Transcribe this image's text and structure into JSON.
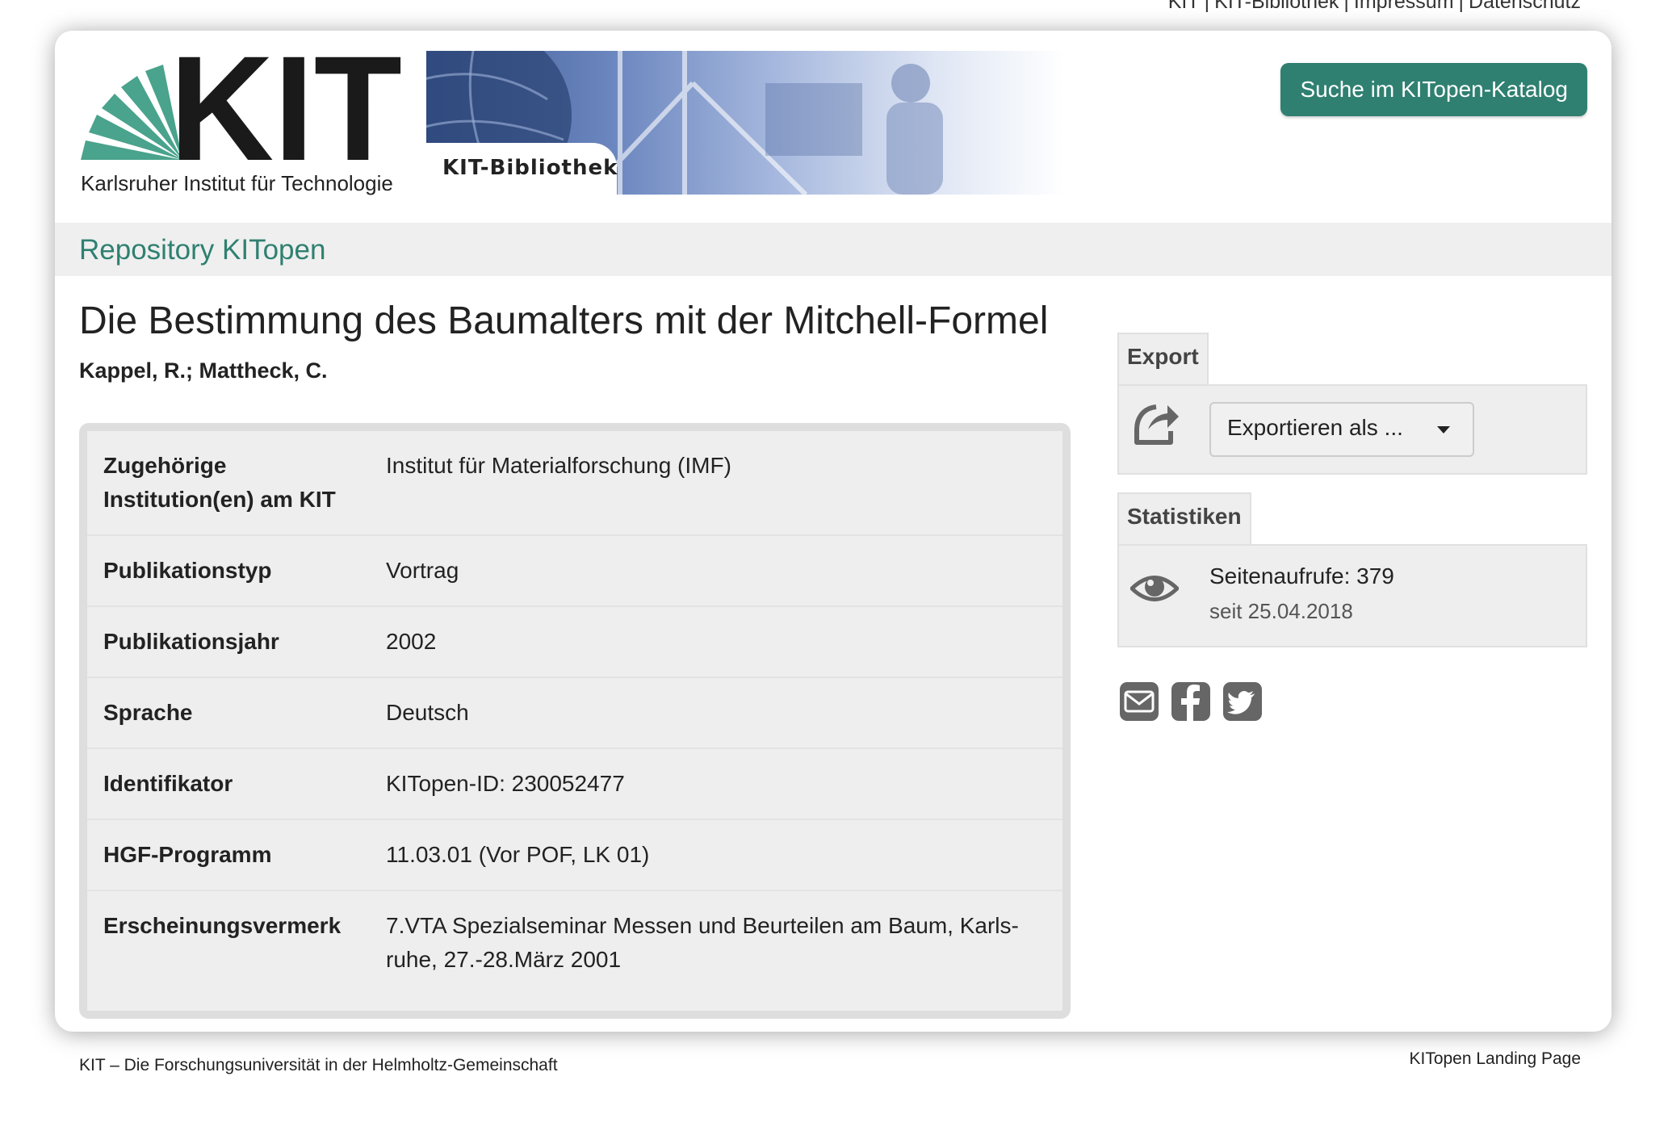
{
  "topnav": {
    "items": [
      "KIT",
      "KIT-Bibliothek",
      "Impressum",
      "Datenschutz"
    ],
    "separator": "|"
  },
  "header": {
    "logo_text": "KIT",
    "tagline": "Karlsruher Institut für Technologie",
    "banner_label": "KIT-Bibliothek",
    "search_button": "Suche im KITopen-Katalog"
  },
  "repo": {
    "title": "Repository KITopen"
  },
  "document": {
    "title": "Die Bestimmung des Baumalters mit der Mitchell-Formel",
    "authors": "Kappel, R.; Mattheck, C."
  },
  "metadata": [
    {
      "key": "Zugehörige Institution(en) am KIT",
      "value": "Institut für Materialforschung (IMF)"
    },
    {
      "key": "Publikationstyp",
      "value": "Vortrag"
    },
    {
      "key": "Publikationsjahr",
      "value": "2002"
    },
    {
      "key": "Sprache",
      "value": "Deutsch"
    },
    {
      "key": "Identifikator",
      "value": "KITopen-ID: 230052477"
    },
    {
      "key": "HGF-Programm",
      "value": "11.03.01 (Vor POF, LK 01)"
    },
    {
      "key": "Erscheinungsvermerk",
      "value": "7.VTA Spezialseminar Messen und Beurteilen am Baum, Karls-ruhe, 27.-28.März 2001"
    }
  ],
  "export": {
    "title": "Export",
    "select_label": "Exportieren als ...",
    "icon": "share-icon"
  },
  "stats": {
    "title": "Statistiken",
    "views": "Seitenaufrufe: 379",
    "since": "seit 25.04.2018",
    "icon": "eye-icon"
  },
  "share": {
    "icons": [
      "email-icon",
      "facebook-icon",
      "twitter-icon"
    ]
  },
  "footer": {
    "left": "KIT – Die Forschungsuniversität in der Helmholtz-Gemeinschaft",
    "right": "KITopen Landing Page"
  },
  "colors": {
    "accent": "#2f8071",
    "logo_green": "#4aa38c",
    "panel_bg": "#eeeeee",
    "icon_gray": "#666666"
  }
}
